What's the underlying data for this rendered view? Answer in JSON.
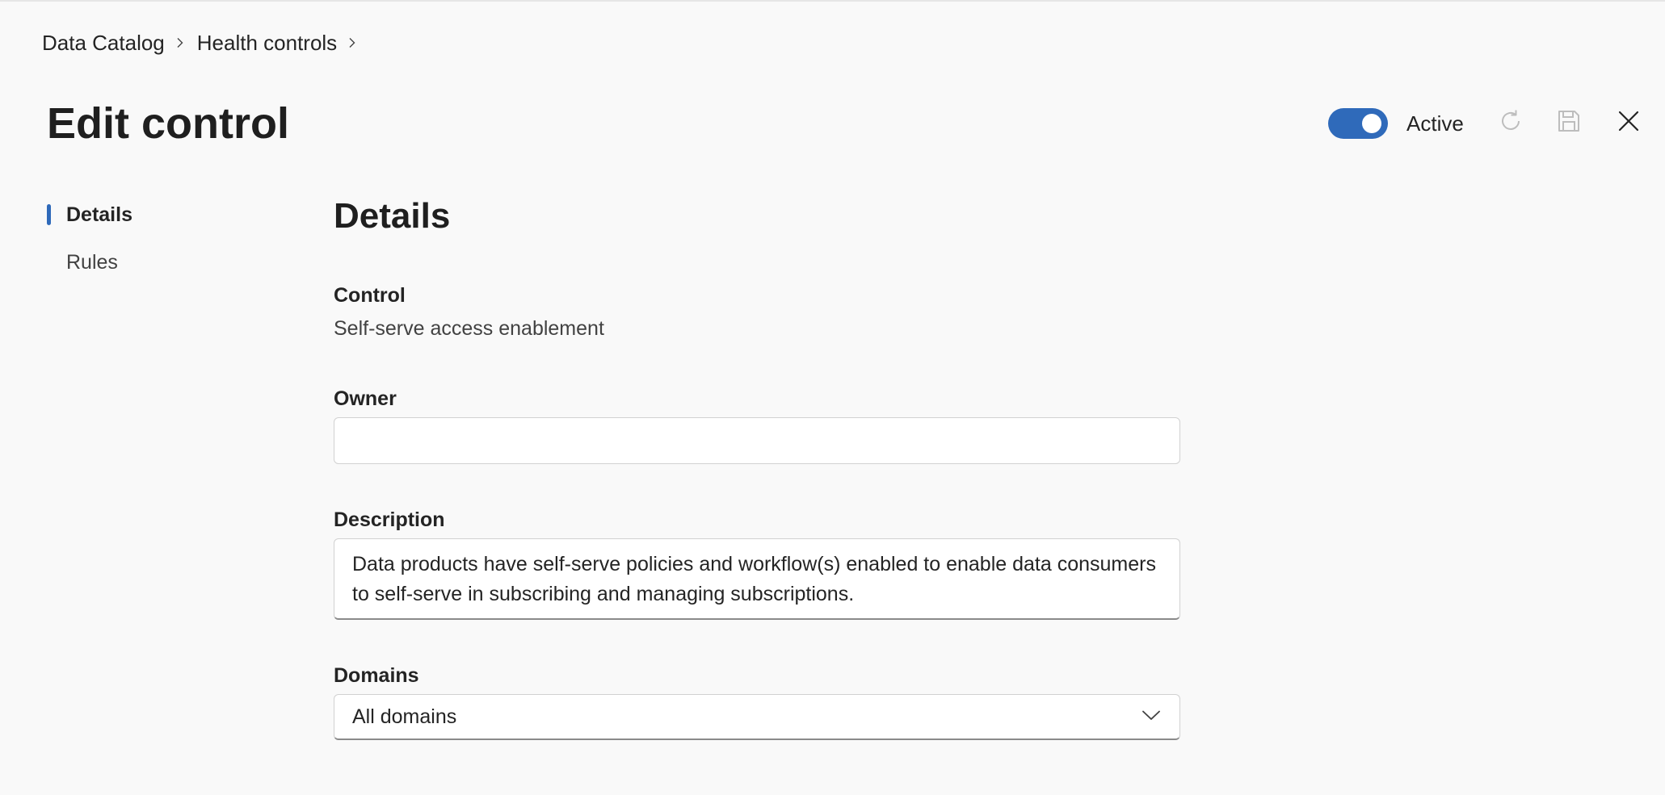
{
  "breadcrumb": {
    "items": [
      "Data Catalog",
      "Health controls"
    ]
  },
  "header": {
    "title": "Edit control",
    "toggle_label": "Active",
    "toggle_on": true
  },
  "nav": {
    "items": [
      {
        "label": "Details",
        "selected": true
      },
      {
        "label": "Rules",
        "selected": false
      }
    ]
  },
  "details": {
    "section_title": "Details",
    "control_label": "Control",
    "control_value": "Self-serve access enablement",
    "owner_label": "Owner",
    "owner_value": "",
    "description_label": "Description",
    "description_value": "Data products have self-serve policies and workflow(s) enabled to enable data consumers to self-serve in subscribing and managing subscriptions.",
    "domains_label": "Domains",
    "domains_value": "All domains"
  },
  "icons": {
    "refresh": "refresh-icon",
    "save": "save-icon",
    "close": "close-icon",
    "chevron": "chevron-down-icon",
    "breadcrumb_separator": "chevron-right-icon"
  },
  "colors": {
    "accent": "#2f6aba",
    "background": "#f9f9f9",
    "disabled_icon": "#bdbdbd"
  }
}
